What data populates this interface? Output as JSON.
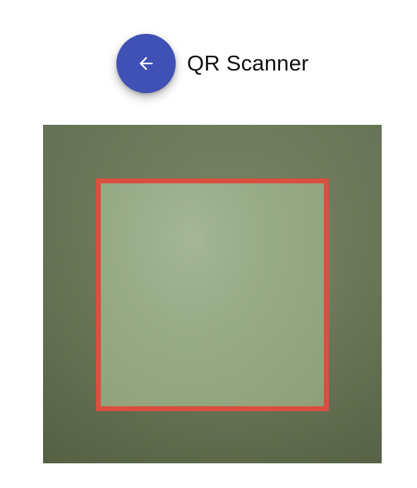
{
  "header": {
    "title": "QR Scanner",
    "back_icon": "arrow-left-icon"
  },
  "colors": {
    "back_button": "#3f51b5",
    "scan_frame": "#d9503f",
    "camera_bg": "#6a7756"
  }
}
